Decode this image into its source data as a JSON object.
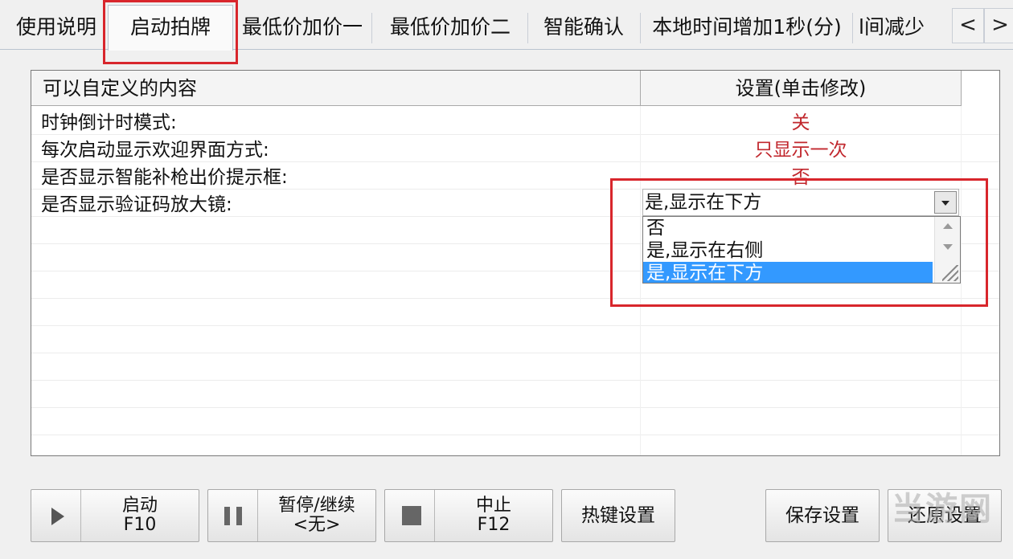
{
  "tabs": [
    {
      "label": "使用说明",
      "active": false
    },
    {
      "label": "启动拍牌",
      "active": true
    },
    {
      "label": "最低价加价一",
      "active": false
    },
    {
      "label": "最低价加价二",
      "active": false
    },
    {
      "label": "智能确认",
      "active": false
    },
    {
      "label": "本地时间增加1秒(分)",
      "active": false
    },
    {
      "label": "l间减少",
      "active": false
    }
  ],
  "tab_scroll": {
    "left": "<",
    "right": ">"
  },
  "grid": {
    "columns": [
      "可以自定义的内容",
      "设置(单击修改)"
    ],
    "rows": [
      {
        "label": "时钟倒计时模式:",
        "value": "关"
      },
      {
        "label": "每次启动显示欢迎界面方式:",
        "value": "只显示一次"
      },
      {
        "label": "是否显示智能补枪出价提示框:",
        "value": "否"
      },
      {
        "label": "是否显示验证码放大镜:",
        "value": ""
      }
    ],
    "combo": {
      "value": "是,显示在下方",
      "options": [
        "否",
        "是,显示在右侧",
        "是,显示在下方"
      ],
      "selected_index": 2
    }
  },
  "buttons": {
    "start": {
      "line1": "启动",
      "line2": "F10"
    },
    "pause": {
      "line1": "暂停/继续",
      "line2": "<无>"
    },
    "stop": {
      "line1": "中止",
      "line2": "F12"
    },
    "hotkey": "热键设置",
    "save": "保存设置",
    "restore": "还原设置"
  },
  "watermark": "当游网",
  "colors": {
    "value_text": "#c1272d",
    "selection": "#3399ff",
    "highlight_box": "#d8262c"
  }
}
